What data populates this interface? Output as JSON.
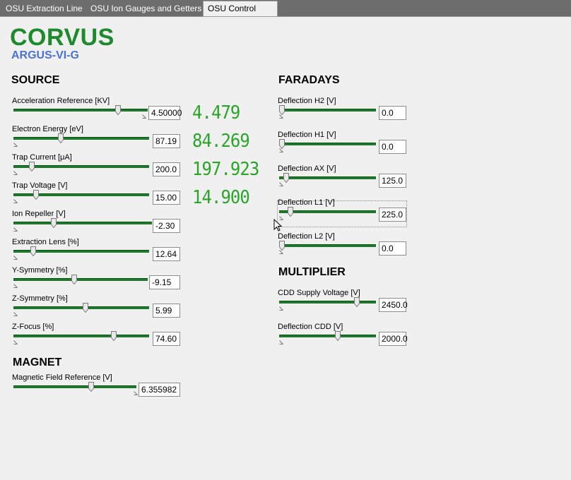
{
  "tabs": [
    {
      "label": "OSU Extraction Line"
    },
    {
      "label": "OSU Ion Gauges and Getters"
    },
    {
      "label": "OSU Control Panel"
    }
  ],
  "header": {
    "title": "CORVUS",
    "subtitle": "ARGUS-VI-G"
  },
  "source": {
    "title": "SOURCE",
    "controls": [
      {
        "label": "Acceleration Reference [KV]",
        "value": "4.50000",
        "position": 0.79
      },
      {
        "label": "Electron Energy [eV]",
        "value": "87.19",
        "position": 0.34
      },
      {
        "label": "Trap Current [μA]",
        "value": "200.0",
        "position": 0.12
      },
      {
        "label": "Trap Voltage [V]",
        "value": "15.00",
        "position": 0.15
      },
      {
        "label": "Ion Repeller [V]",
        "value": "-2.30",
        "position": 0.28
      },
      {
        "label": "Extraction Lens [%]",
        "value": "12.64",
        "position": 0.13
      },
      {
        "label": "Y-Symmetry [%]",
        "value": "-9.15",
        "position": 0.45
      },
      {
        "label": "Z-Symmetry [%]",
        "value": "5.99",
        "position": 0.53
      },
      {
        "label": "Z-Focus [%]",
        "value": "74.60",
        "position": 0.75
      }
    ],
    "readouts": [
      "4.479",
      "84.269",
      "197.923",
      "14.900"
    ]
  },
  "magnet": {
    "title": "MAGNET",
    "controls": [
      {
        "label": "Magnetic Field Reference [V]",
        "value": "6.355982",
        "position": 0.64
      }
    ]
  },
  "faradays": {
    "title": "FARADAYS",
    "controls": [
      {
        "label": "Deflection H2 [V]",
        "value": "0.0",
        "position": 0.0
      },
      {
        "label": "Deflection H1 [V]",
        "value": "0.0",
        "position": 0.0
      },
      {
        "label": "Deflection AX [V]",
        "value": "125.0",
        "position": 0.05
      },
      {
        "label": "Deflection L1 [V]",
        "value": "225.0",
        "position": 0.09
      },
      {
        "label": "Deflection L2 [V]",
        "value": "0.0",
        "position": 0.0
      }
    ]
  },
  "multiplier": {
    "title": "MULTIPLIER",
    "controls": [
      {
        "label": "CDD Supply Voltage [V]",
        "value": "2450.0",
        "position": 0.82
      },
      {
        "label": "Deflection CDD [V]",
        "value": "2000.0",
        "position": 0.61
      }
    ]
  },
  "colors": {
    "accent_green": "#1e8a2e",
    "subtitle_blue": "#4a73d6",
    "readout_green": "#2aa52a",
    "track_green": "#207a2d"
  },
  "icons": {
    "thumb": "slider-thumb-icon",
    "cursor": "mouse-cursor-icon"
  }
}
